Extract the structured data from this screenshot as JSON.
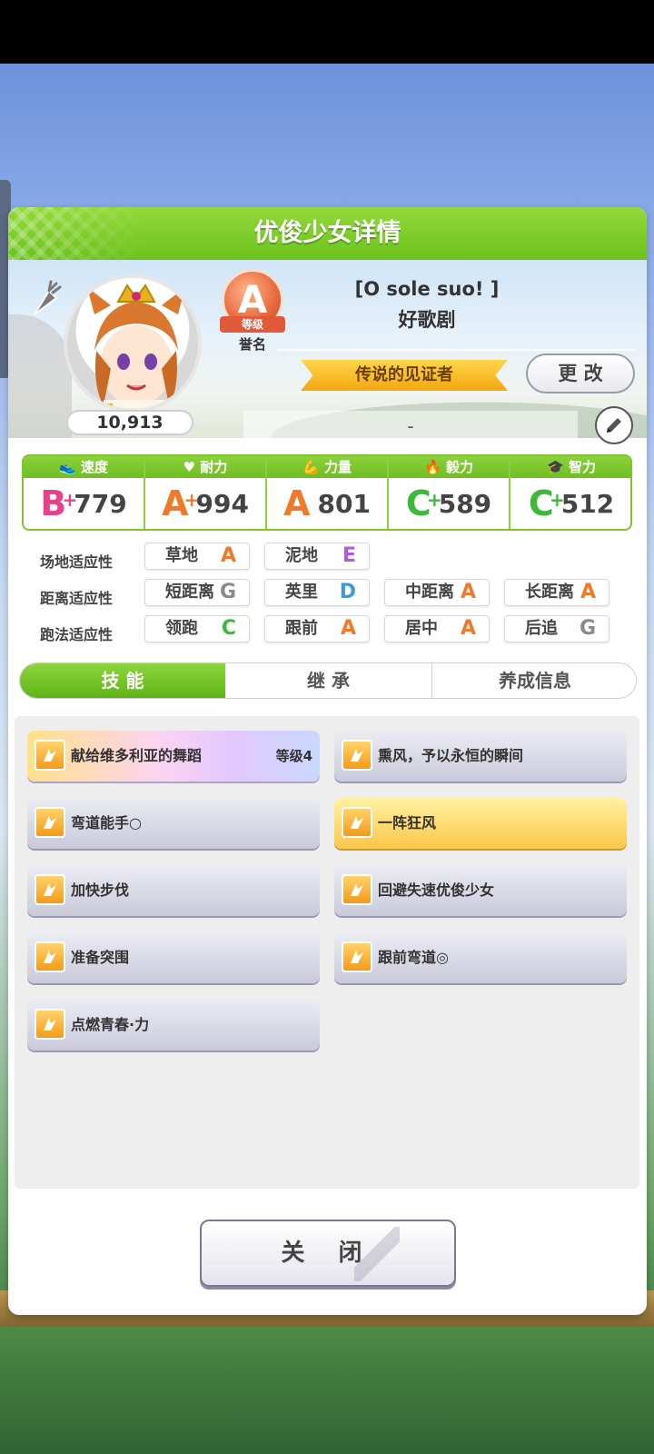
{
  "window": {
    "title": "优俊少女详情"
  },
  "profile": {
    "fans": "10,913",
    "rank": {
      "grade": "A",
      "ribbon": "等级",
      "label": "誉名"
    },
    "character_title": "[O sole suo! ]",
    "character_name": "好歌剧",
    "epithet": "传说的见证者",
    "change_button": "更 改",
    "memo": "-"
  },
  "stats": [
    {
      "label": "速度",
      "grade": "B",
      "plus": "+",
      "value": "779",
      "grade_color": "#e8408a",
      "icon": "shoe-icon"
    },
    {
      "label": "耐力",
      "grade": "A",
      "plus": "+",
      "value": "994",
      "grade_color": "#f07a2a",
      "icon": "heart-icon"
    },
    {
      "label": "力量",
      "grade": "A",
      "plus": "",
      "value": "801",
      "grade_color": "#f07a2a",
      "icon": "muscle-icon"
    },
    {
      "label": "毅力",
      "grade": "C",
      "plus": "+",
      "value": "589",
      "grade_color": "#3db83a",
      "icon": "flame-icon"
    },
    {
      "label": "智力",
      "grade": "C",
      "plus": "+",
      "value": "512",
      "grade_color": "#3db83a",
      "icon": "graduation-cap-icon"
    }
  ],
  "aptitudes": {
    "track": {
      "label": "场地适应性",
      "items": [
        {
          "name": "草地",
          "grade": "A"
        },
        {
          "name": "泥地",
          "grade": "E"
        }
      ]
    },
    "distance": {
      "label": "距离适应性",
      "items": [
        {
          "name": "短距离",
          "grade": "G"
        },
        {
          "name": "英里",
          "grade": "D"
        },
        {
          "name": "中距离",
          "grade": "A"
        },
        {
          "name": "长距离",
          "grade": "A"
        }
      ]
    },
    "style": {
      "label": "跑法适应性",
      "items": [
        {
          "name": "领跑",
          "grade": "C"
        },
        {
          "name": "跟前",
          "grade": "A"
        },
        {
          "name": "居中",
          "grade": "A"
        },
        {
          "name": "后追",
          "grade": "G"
        }
      ]
    }
  },
  "grade_colors": {
    "A": "#f07a2a",
    "C": "#3db83a",
    "D": "#3a9ae0",
    "E": "#b35ad8",
    "G": "#8a8a8a"
  },
  "tabs": [
    {
      "label": "技 能",
      "active": true
    },
    {
      "label": "继 承"
    },
    {
      "label": "养成信息"
    }
  ],
  "skills": [
    {
      "name": "献给维多利亚的舞蹈",
      "level": "等级4",
      "style": "rainbow"
    },
    {
      "name": "熏风，予以永恒的瞬间",
      "level": "",
      "style": "normal"
    },
    {
      "name": "弯道能手○",
      "level": "",
      "style": "normal"
    },
    {
      "name": "一阵狂风",
      "level": "",
      "style": "gold"
    },
    {
      "name": "加快步伐",
      "level": "",
      "style": "normal"
    },
    {
      "name": "回避失速优俊少女",
      "level": "",
      "style": "normal"
    },
    {
      "name": "准备突围",
      "level": "",
      "style": "normal"
    },
    {
      "name": "跟前弯道◎",
      "level": "",
      "style": "normal"
    },
    {
      "name": "点燃青春·力",
      "level": "",
      "style": "normal"
    }
  ],
  "close_button": "关 闭"
}
